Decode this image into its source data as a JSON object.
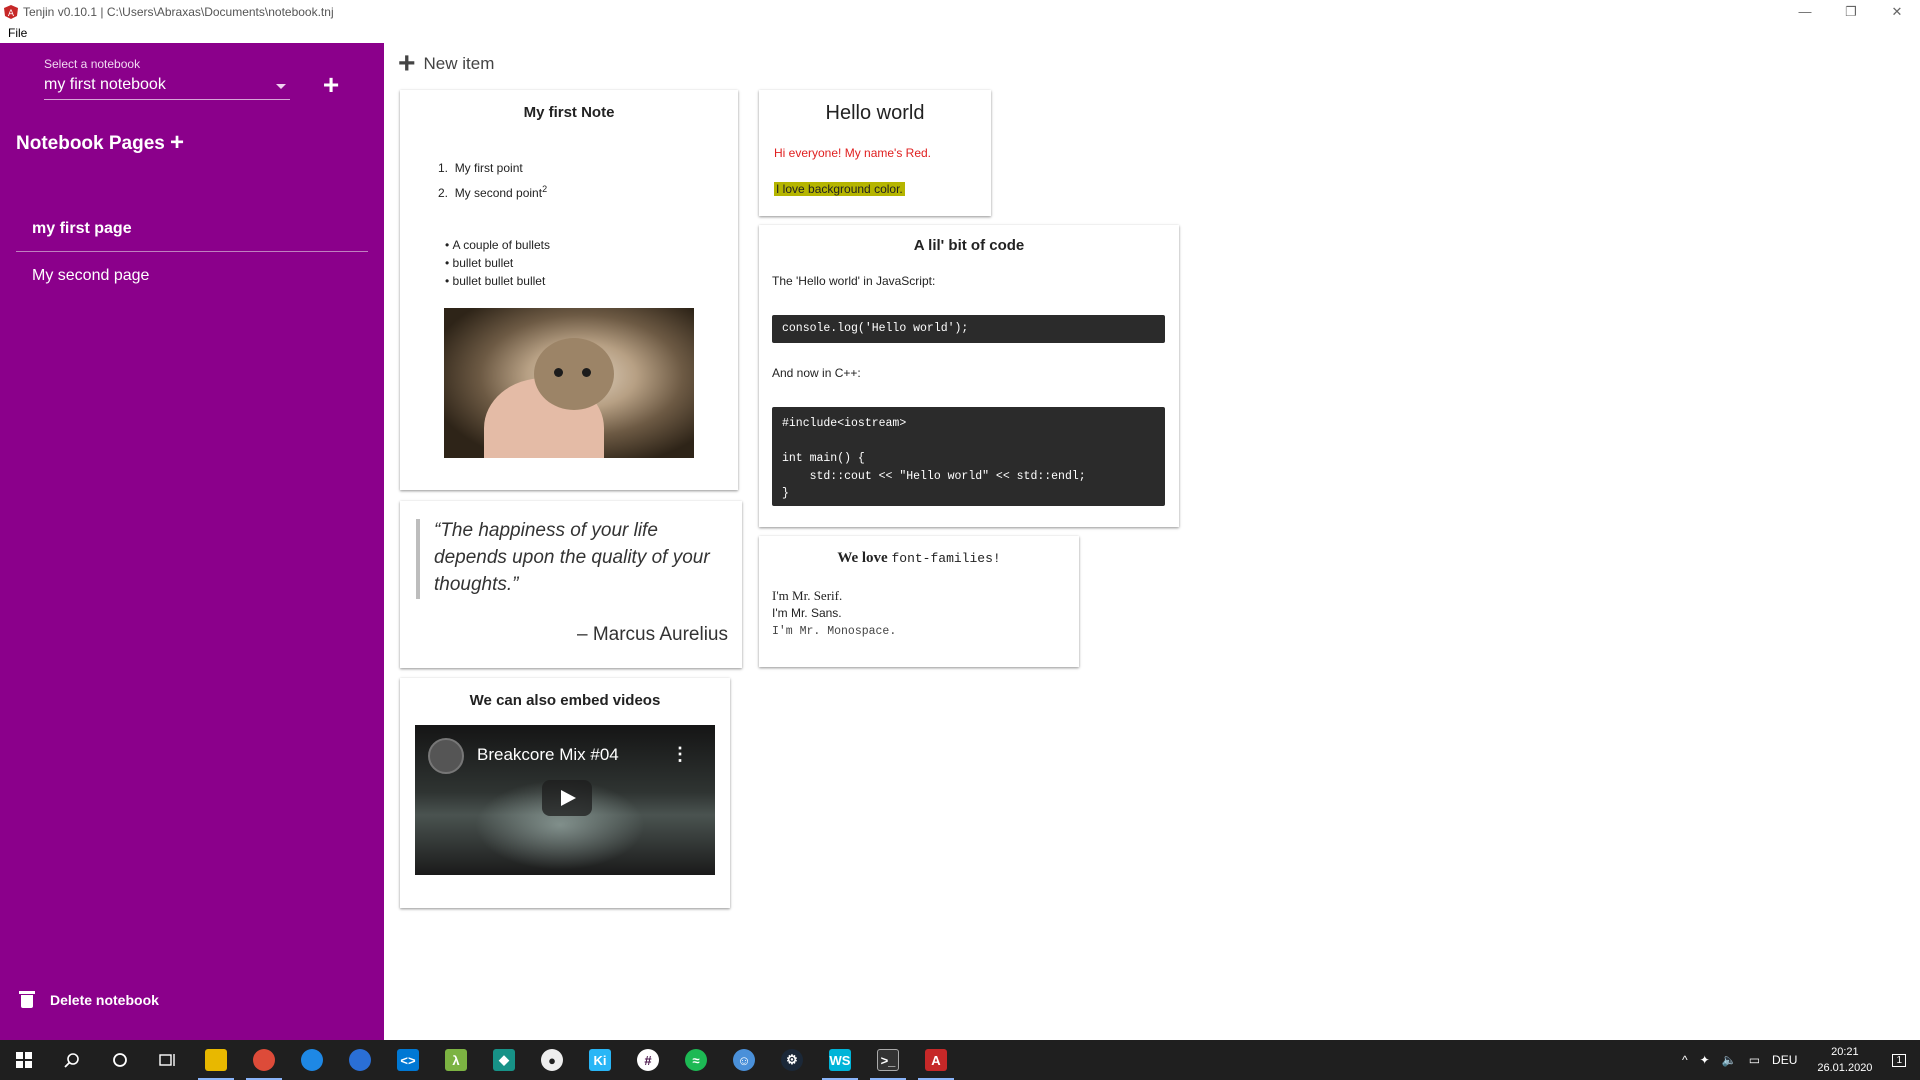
{
  "window": {
    "title": "Tenjin v0.10.1 | C:\\Users\\Abraxas\\Documents\\notebook.tnj",
    "menu": [
      "File"
    ]
  },
  "sidebar": {
    "select_label": "Select a notebook",
    "selected_notebook": "my first notebook",
    "pages_title": "Notebook Pages",
    "pages": [
      {
        "label": "my first page",
        "active": true
      },
      {
        "label": "My second page",
        "active": false
      }
    ],
    "delete_label": "Delete notebook"
  },
  "main": {
    "new_item_label": "New item",
    "cards": {
      "first_note": {
        "title": "My first Note",
        "ordered": [
          "My first point",
          "My second point"
        ],
        "ordered_sup": "2",
        "bullets": [
          "A couple of bullets",
          "bullet bullet",
          "bullet bullet bullet"
        ]
      },
      "hello": {
        "title": "Hello world",
        "red_text": "Hi everyone! My name's Red.",
        "highlight_text": "I love background color.",
        "red_color": "#e02020",
        "highlight_color": "#b5b500"
      },
      "code": {
        "title": "A lil' bit of code",
        "js_label": "The 'Hello world' in JavaScript:",
        "js_code": "console.log('Hello world');",
        "cpp_label": "And now in C++:",
        "cpp_code": "#include<iostream>\n\nint main() {\n    std::cout << \"Hello world\" << std::endl;\n}"
      },
      "quote": {
        "text": "“The happiness of your life depends upon the quality of your thoughts.”",
        "author": "– Marcus Aurelius"
      },
      "fonts": {
        "title_prefix": "We love ",
        "title_mono": "font-families!",
        "serif": "I'm Mr. Serif.",
        "sans": "I'm Mr. Sans.",
        "mono": "I'm Mr. Monospace."
      },
      "video": {
        "title": "We can also embed videos",
        "video_title": "Breakcore Mix #04"
      }
    }
  },
  "taskbar": {
    "language": "DEU",
    "time": "20:21",
    "date": "26.01.2020",
    "notification_count": "1"
  },
  "colors": {
    "sidebar": "#8b008b",
    "taskbar": "#1f1f1f"
  }
}
